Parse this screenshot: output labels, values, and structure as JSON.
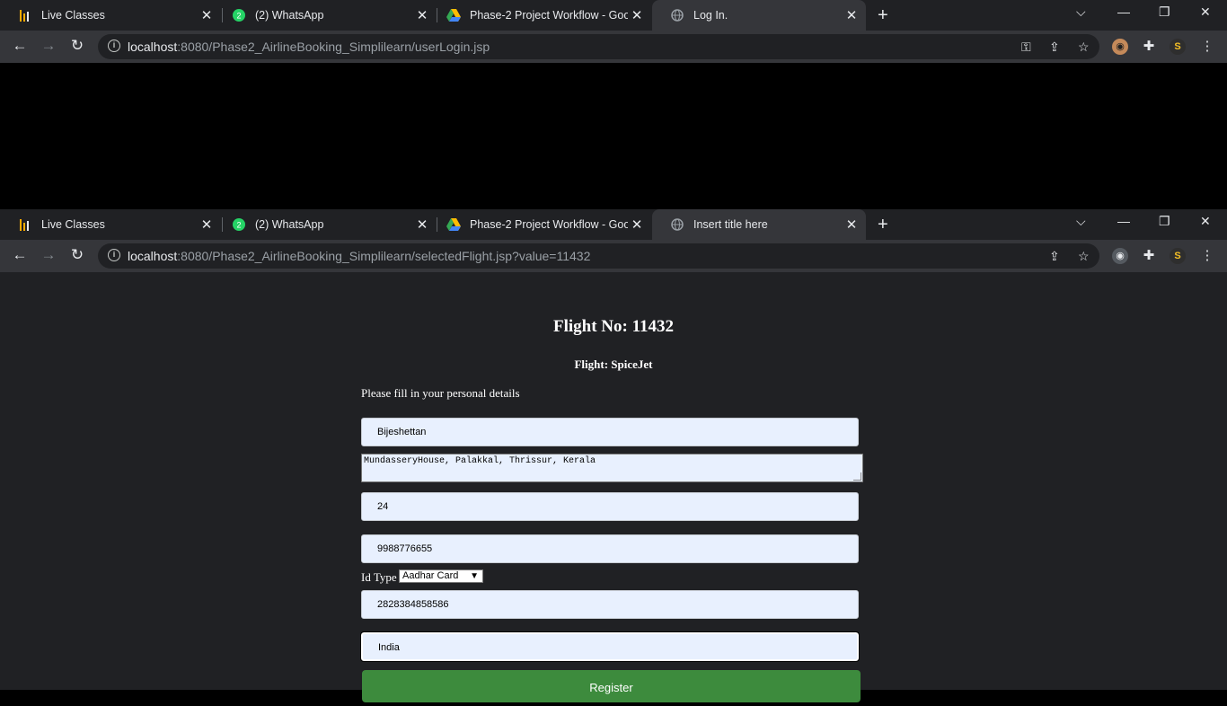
{
  "windows": [
    {
      "tabs": [
        {
          "title": "Live Classes",
          "icon": "live-classes-icon"
        },
        {
          "title": "(2) WhatsApp",
          "icon": "whatsapp-icon"
        },
        {
          "title": "Phase-2 Project Workflow - Goog",
          "icon": "google-drive-icon"
        },
        {
          "title": "Log In.",
          "icon": "globe-icon",
          "active": true
        }
      ],
      "url_host": "localhost",
      "url_path": ":8080/Phase2_AirlineBooking_Simplilearn/userLogin.jsp"
    },
    {
      "tabs": [
        {
          "title": "Live Classes",
          "icon": "live-classes-icon"
        },
        {
          "title": "(2) WhatsApp",
          "icon": "whatsapp-icon"
        },
        {
          "title": "Phase-2 Project Workflow - Goog",
          "icon": "google-drive-icon"
        },
        {
          "title": "Insert title here",
          "icon": "globe-icon",
          "active": true
        }
      ],
      "url_host": "localhost",
      "url_path": ":8080/Phase2_AirlineBooking_Simplilearn/selectedFlight.jsp?value=11432"
    }
  ],
  "page": {
    "heading": "Flight No: 11432",
    "subheading": "Flight: SpiceJet",
    "intro": "Please fill in your personal details",
    "name_value": "Bijeshettan",
    "address_value": "MundasseryHouse, Palakkal, Thrissur, Kerala",
    "age_value": "24",
    "phone_value": "9988776655",
    "id_type_label": "Id Type",
    "id_type_value": "Aadhar Card",
    "id_number_value": "2828384858586",
    "nationality_value": "India",
    "register_label": "Register"
  },
  "colors": {
    "register_button": "#3d8b3d",
    "input_background": "#e8f0fe",
    "page_background": "#202124"
  }
}
